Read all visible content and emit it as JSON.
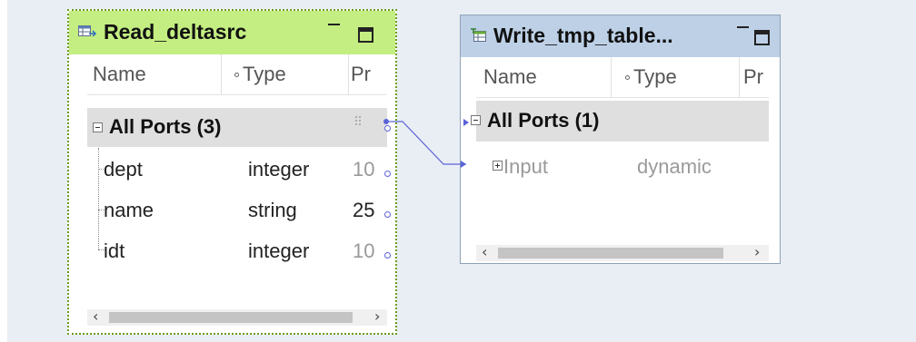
{
  "source": {
    "title": "Read_deltasrc",
    "columns": {
      "name": "Name",
      "type": "Type",
      "precision": "Pr"
    },
    "group_label": "All Ports (3)",
    "ports": [
      {
        "name": "dept",
        "type": "integer",
        "precision": "10"
      },
      {
        "name": "name",
        "type": "string",
        "precision": "25"
      },
      {
        "name": "idt",
        "type": "integer",
        "precision": "10"
      }
    ]
  },
  "target": {
    "title": "Write_tmp_table...",
    "columns": {
      "name": "Name",
      "type": "Type",
      "precision": "Pr"
    },
    "group_label": "All Ports (1)",
    "ports": [
      {
        "name": "Input",
        "type": "dynamic"
      }
    ]
  },
  "icons": {
    "source_icon": "read-table-icon",
    "target_icon": "write-table-icon",
    "minimize": "minimize-icon",
    "maximize": "maximize-icon"
  },
  "colors": {
    "source_title_bg": "#c4ee82",
    "target_title_bg": "#bdd0e6",
    "link": "#5b63d8",
    "canvas": "#e9eef4"
  }
}
